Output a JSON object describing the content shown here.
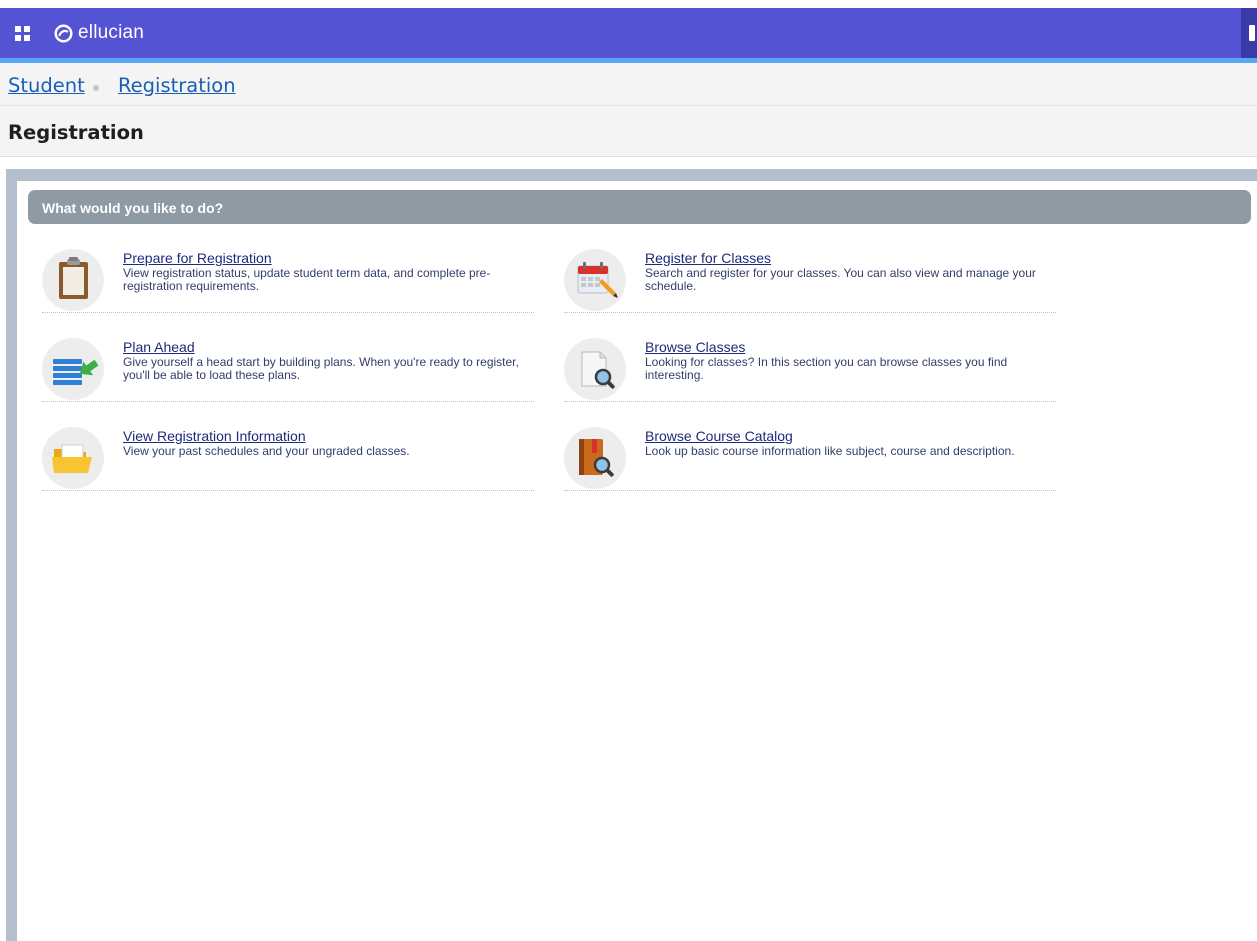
{
  "app": {
    "brand": "ellucian",
    "icons": {
      "menu": "grid-menu-icon",
      "logo": "ellucian-logo-icon"
    },
    "colors": {
      "topbar": "#5353d3",
      "accent": "#56a8f5",
      "link": "#1a5fb4"
    }
  },
  "breadcrumb": {
    "items": [
      {
        "label": "Student"
      },
      {
        "label": "Registration"
      }
    ]
  },
  "page": {
    "title": "Registration"
  },
  "section": {
    "title": "What would you like to do?",
    "items": [
      {
        "title": "Prepare for Registration",
        "description": "View registration status, update student term data, and complete pre-registration requirements.",
        "icon": "clipboard-icon"
      },
      {
        "title": "Register for Classes",
        "description": "Search and register for your classes. You can also view and manage your schedule.",
        "icon": "calendar-pencil-icon"
      },
      {
        "title": "Plan Ahead",
        "description": "Give yourself a head start by building plans. When you're ready to register, you'll be able to load these plans.",
        "icon": "list-arrow-icon"
      },
      {
        "title": "Browse Classes",
        "description": "Looking for classes? In this section you can browse classes you find interesting.",
        "icon": "document-magnifier-icon"
      },
      {
        "title": "View Registration Information",
        "description": "View your past schedules and your ungraded classes.",
        "icon": "folder-icon"
      },
      {
        "title": "Browse Course Catalog",
        "description": "Look up basic course information like subject, course and description.",
        "icon": "book-magnifier-icon"
      }
    ]
  }
}
